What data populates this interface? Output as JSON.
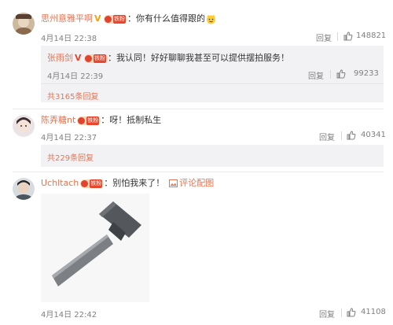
{
  "comments": [
    {
      "user": "思州意雅平啊",
      "text": "：你有什么值得跟的",
      "emoji": "smiling-cat-face-emoji",
      "time": "4月14日 22:38",
      "reply_label": "回复",
      "likes": "148821",
      "sub_reply": {
        "user": "张雨剑",
        "text": "：我认同！好好聊聊我甚至可以提供摆拍服务！",
        "time": "4月14日 22:39",
        "reply_label": "回复",
        "likes": "99233"
      },
      "more_replies": "共3165条回复"
    },
    {
      "user": "陈弄糖nt",
      "text": "：呀！抵制私生",
      "time": "4月14日 22:37",
      "reply_label": "回复",
      "likes": "40341",
      "more_replies": "共229条回复"
    },
    {
      "user": "Uchltach",
      "text": "：别怕我来了！",
      "comment_image_label": "评论配图",
      "time": "4月14日 22:42",
      "reply_label": "回复",
      "likes": "41108"
    }
  ],
  "badges": {
    "fan_label": "铁粉",
    "v_label": "V"
  },
  "colors": {
    "link_orange": "#eb7350",
    "gray_text": "#808080",
    "sub_bg": "#f2f2f5"
  }
}
